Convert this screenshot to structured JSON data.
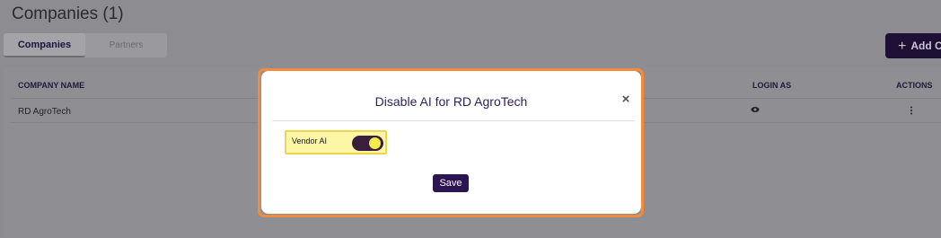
{
  "page": {
    "title": "Companies (1)",
    "tabs": [
      {
        "label": "Companies",
        "active": true
      },
      {
        "label": "Partners",
        "active": false
      }
    ],
    "add_button": {
      "icon": "plus-icon",
      "label": "Add C"
    }
  },
  "table": {
    "columns": [
      "COMPANY NAME",
      "LOGIN AS",
      "ACTIONS"
    ],
    "rows": [
      {
        "company_name": "RD AgroTech",
        "login_as_icon": "eye-icon",
        "actions_icon": "kebab-icon"
      }
    ]
  },
  "modal": {
    "title": "Disable AI for RD AgroTech",
    "close_icon": "close-icon",
    "close_glyph": "×",
    "toggle": {
      "label": "Vendor AI",
      "enabled": true
    },
    "save_label": "Save"
  },
  "colors": {
    "brand_dark": "#2d1553",
    "highlight_border": "#f08c3b",
    "field_highlight": "#fdf6a6",
    "toggle_knob": "#f5ea4a"
  }
}
